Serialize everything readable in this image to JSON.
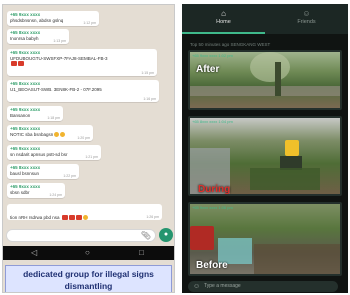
{
  "left_phone": {
    "messages": [
      {
        "sender": "+65 9xxx xxxx",
        "text": "phsdsbnsnsn, abdsn gslnq"
      },
      {
        "sender": "+65 8xxx xxxx",
        "text": "Inonrsa babyh"
      },
      {
        "sender": "+65 9xxx xxxx",
        "text": "UFDUBOUGTU-SWSFXP-7FAJ8-SEMBAL-FB-3"
      },
      {
        "sender": "+65 8xxx xxxx",
        "text": "U1_BEOASUT-SWB. 3EN8K-FB-2 - 07F.2095"
      },
      {
        "sender": "+65 9xxx xxxx",
        "text": "Bansanon"
      },
      {
        "sender": "+65 8xxx xxxx",
        "text": "NOTIC sba bsnbagsn"
      },
      {
        "sender": "+65 9xxx xxxx",
        "text": "sn nsdarit apnsus pstt-sd bsr"
      },
      {
        "sender": "+65 8xxx xxxx",
        "text": "bausl bsnnsun"
      },
      {
        "sender": "+65 9xxx xxxx",
        "text": "sbsn sdbr"
      },
      {
        "sender": "+65 8xxx xxxx",
        "text": "Ok"
      }
    ],
    "reply_text": "tion nRH rsdrwa pbd nsa",
    "times": [
      "1:12 pm",
      "1:13 pm",
      "1:15 pm",
      "1:16 pm",
      "1:18 pm",
      "1:20 pm",
      "1:21 pm",
      "1:22 pm",
      "1:24 pm",
      "1:25 pm",
      "1:26 pm"
    ],
    "attach_icon": "paperclip-icon",
    "send_icon": "mic-icon",
    "nav_icons": [
      "back-icon",
      "home-icon",
      "recents-icon"
    ],
    "caption": [
      "dedicated group for illegal signs",
      "dismantling"
    ]
  },
  "right_phone": {
    "tabs": [
      {
        "label": "Home",
        "icon": "home-icon"
      },
      {
        "label": "Friends",
        "icon": "friends-icon"
      }
    ],
    "notice": "Top 50 minutes ago SENGKANG WEST",
    "photos": [
      {
        "meta": "+65 9xxx xxxx  1:02 pm",
        "label": "After"
      },
      {
        "meta": "+65 8xxx xxxx  1:04 pm",
        "label": "During"
      },
      {
        "meta": "+65 9xxx xxxx  1:06 pm",
        "label": "Before"
      }
    ],
    "input_placeholder": "Type a message"
  },
  "colors": {
    "chat_background": "#e4ddd3",
    "accent_green": "#25956f",
    "caption_text": "#1f3072",
    "dark_background": "#101412"
  }
}
